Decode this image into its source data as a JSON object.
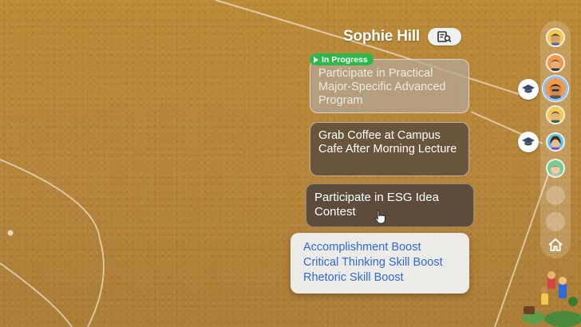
{
  "player": {
    "name": "Sophie Hill"
  },
  "status_badge": "In Progress",
  "tasks": [
    {
      "label": "Participate in Practical Major-Specific Advanced Program",
      "state": "in-progress"
    },
    {
      "label": "Grab Coffee at Campus Cafe After Morning Lecture",
      "state": "available"
    },
    {
      "label": "Participate in ESG Idea Contest",
      "state": "hovered"
    }
  ],
  "boost_popup": {
    "items": [
      "Accomplishment Boost",
      "Critical Thinking Skill Boost",
      "Rhetoric Skill Boost"
    ]
  },
  "side_rail": {
    "avatars": [
      {
        "name": "character-avatar-1",
        "skin": "#d9a06b",
        "hair": "#5a3a22",
        "bg": "#f2c94c",
        "selected": false
      },
      {
        "name": "character-avatar-2",
        "skin": "#e3b07e",
        "hair": "#7a4a22",
        "bg": "#f2994a",
        "selected": false
      },
      {
        "name": "character-avatar-3",
        "skin": "#c98a55",
        "hair": "#3d2616",
        "bg": "#f2994a",
        "selected": true
      },
      {
        "name": "character-avatar-4",
        "skin": "#e6b47f",
        "hair": "#6b3b1a",
        "bg": "#f2c94c",
        "selected": false
      },
      {
        "name": "character-avatar-5",
        "skin": "#e8bf95",
        "hair": "#4a2c1a",
        "bg": "#56ccf2",
        "selected": false
      },
      {
        "name": "character-avatar-6",
        "skin": "#f0caa0",
        "hair": "#9a8a7a",
        "bg": "#6fcf97",
        "selected": false
      }
    ],
    "empty_slots": 2
  },
  "colors": {
    "accent_blue": "#2f6ad8",
    "status_green": "#2db84b",
    "selected_ring": "#8ec5ff"
  }
}
